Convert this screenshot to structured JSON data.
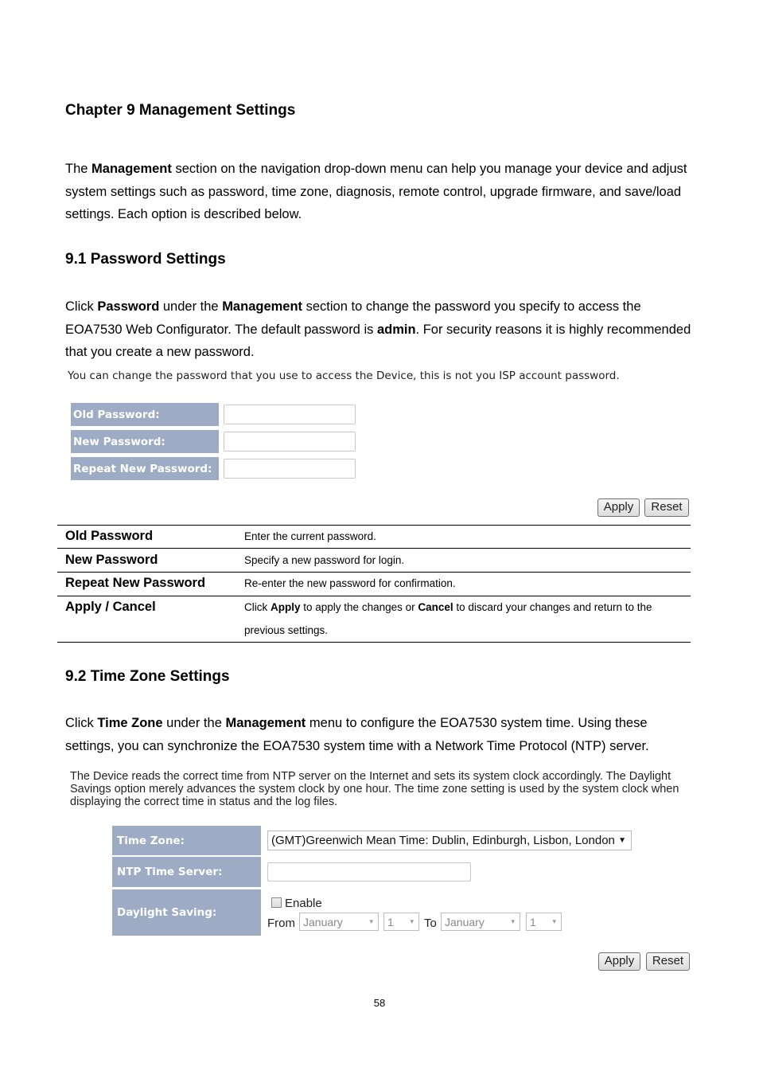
{
  "chapter_title": "Chapter 9 Management Settings",
  "intro": {
    "t1": "The ",
    "b1": "Management",
    "t2": " section on the navigation drop-down menu can help you manage your device and adjust system settings such as password, time zone, diagnosis, remote control, upgrade firmware, and save/load settings. Each option is described below."
  },
  "sec91": {
    "title": "9.1 Password Settings",
    "p": {
      "t1": "Click ",
      "b1": "Password",
      "t2": " under the ",
      "b2": "Management",
      "t3": " section to change the password you specify to access the EOA7530 Web Configurator. The default password is ",
      "b3": "admin",
      "t4": ". For security reasons it is highly recommended that you create a new password."
    },
    "ui_note": "You can change the password that you use to access the Device, this is not you ISP account password.",
    "fields": [
      {
        "label": "Old Password:",
        "value": ""
      },
      {
        "label": "New Password:",
        "value": ""
      },
      {
        "label": "Repeat New Password:",
        "value": ""
      }
    ],
    "apply_label": "Apply",
    "reset_label": "Reset",
    "table": [
      {
        "term": "Old Password",
        "desc": "Enter the current password."
      },
      {
        "term": "New Password",
        "desc": "Specify a new password for login."
      },
      {
        "term": "Repeat New Password",
        "desc": "Re-enter the new password for confirmation."
      },
      {
        "term": "Apply / Cancel",
        "d1": "Click ",
        "db1": "Apply",
        "d2": " to apply the changes or ",
        "db2": "Cancel",
        "d3": " to discard your changes and return to the previous settings."
      }
    ]
  },
  "sec92": {
    "title": "9.2 Time Zone Settings",
    "p": {
      "t1": "Click ",
      "b1": "Time Zone",
      "t2": " under the ",
      "b2": "Management",
      "t3": " menu to configure the EOA7530 system time. Using these settings, you can synchronize the EOA7530 system time with a Network Time Protocol (NTP) server."
    },
    "ui_note": "The Device reads the correct time from NTP server on the Internet and sets its system clock accordingly. The Daylight Savings option merely advances the system clock by one hour. The time zone setting is used by the system clock when displaying the correct time in status and the log files.",
    "time_zone_label": "Time Zone:",
    "time_zone_value": "(GMT)Greenwich Mean Time: Dublin, Edinburgh, Lisbon, London",
    "ntp_label": "NTP Time Server:",
    "ntp_value": "",
    "dst_label": "Daylight Saving:",
    "enable_label": "Enable",
    "enable_checked": false,
    "from_label": "From",
    "to_label": "To",
    "from_month": "January",
    "from_day": "1",
    "to_month": "January",
    "to_day": "1",
    "apply_label": "Apply",
    "reset_label": "Reset"
  },
  "page_number": "58",
  "icons": {
    "dropdown": "▼",
    "dropdown_gray": "▾"
  }
}
